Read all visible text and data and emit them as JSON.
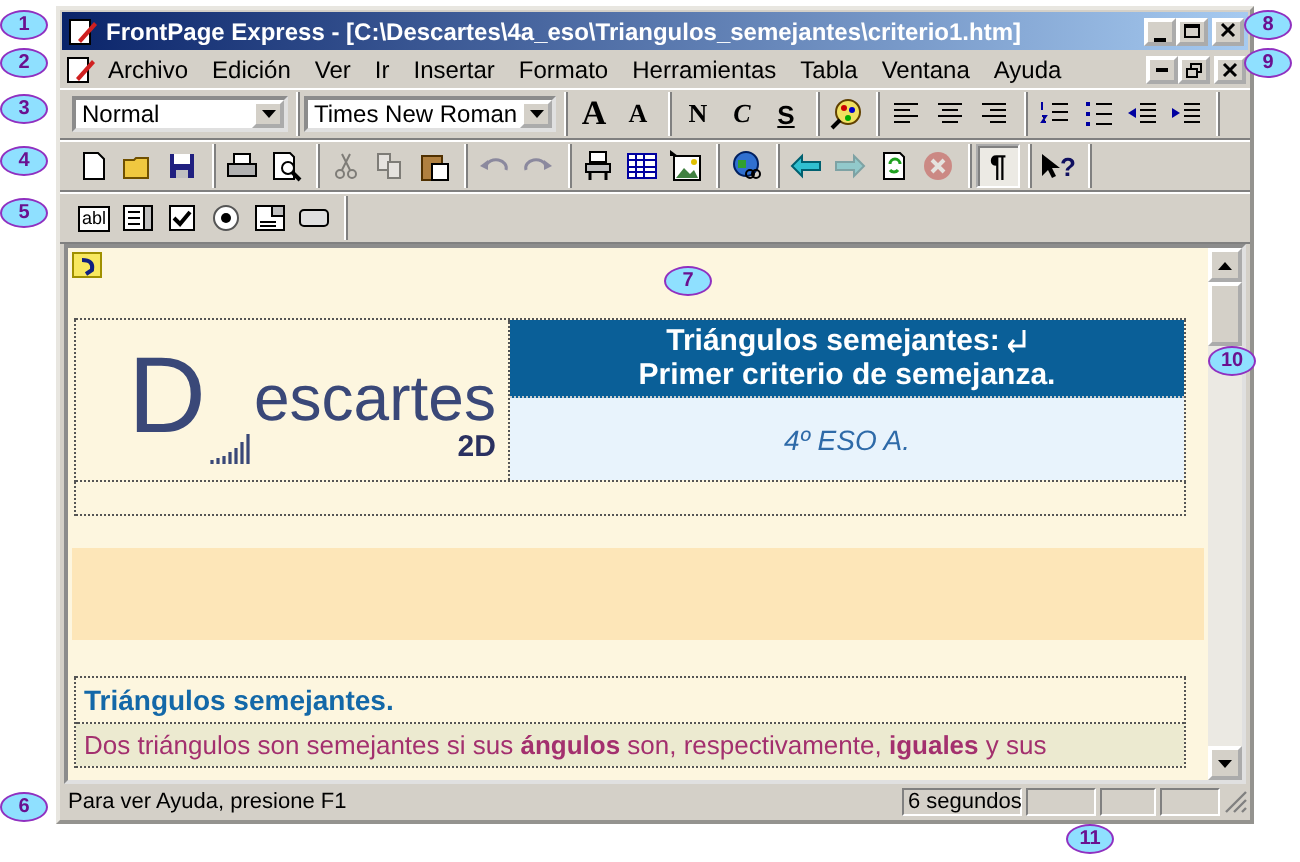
{
  "window": {
    "title": "FrontPage Express - [C:\\Descartes\\4a_eso\\Triangulos_semejantes\\criterio1.htm]"
  },
  "menu_bar": {
    "items": [
      "Archivo",
      "Edición",
      "Ver",
      "Ir",
      "Insertar",
      "Formato",
      "Herramientas",
      "Tabla",
      "Ventana",
      "Ayuda"
    ]
  },
  "toolbars": [
    {
      "groups": [
        [
          {
            "kind": "dropdown",
            "value": "Normal"
          }
        ],
        [
          {
            "kind": "fontbox",
            "value": "Times New Roman"
          }
        ],
        [
          {
            "kind": "grow",
            "label": "A",
            "disabled": false,
            "pressed": false
          },
          {
            "kind": "shrink",
            "label": "A",
            "disabled": false,
            "pressed": false
          }
        ],
        [
          {
            "kind": "bold",
            "label": "N",
            "disabled": false,
            "pressed": false
          },
          {
            "kind": "italic",
            "label": "C",
            "disabled": false,
            "pressed": false
          },
          {
            "kind": "underline",
            "label": "S",
            "disabled": false,
            "pressed": false
          }
        ],
        [
          {
            "kind": "color",
            "disabled": false,
            "pressed": false
          }
        ],
        [
          {
            "kind": "left",
            "disabled": false,
            "pressed": false
          },
          {
            "kind": "center",
            "disabled": false,
            "pressed": false
          },
          {
            "kind": "right",
            "disabled": false,
            "pressed": false
          }
        ],
        [
          {
            "kind": "numbers",
            "disabled": false,
            "pressed": false
          },
          {
            "kind": "bullets",
            "disabled": false,
            "pressed": false
          },
          {
            "kind": "outdent",
            "disabled": false,
            "pressed": false
          },
          {
            "kind": "indent",
            "disabled": false,
            "pressed": false
          }
        ]
      ]
    },
    {
      "groups": [
        [
          {
            "kind": "new",
            "disabled": false,
            "pressed": false
          },
          {
            "kind": "open",
            "disabled": false,
            "pressed": false
          },
          {
            "kind": "save",
            "disabled": false,
            "pressed": false
          }
        ],
        [
          {
            "kind": "print",
            "disabled": false,
            "pressed": false
          },
          {
            "kind": "preview",
            "disabled": false,
            "pressed": false
          }
        ],
        [
          {
            "kind": "cut",
            "disabled": true,
            "pressed": false
          },
          {
            "kind": "copy",
            "disabled": true,
            "pressed": false
          },
          {
            "kind": "paste",
            "disabled": false,
            "pressed": false
          }
        ],
        [
          {
            "kind": "undo",
            "disabled": true,
            "pressed": false
          },
          {
            "kind": "redo",
            "disabled": true,
            "pressed": false
          }
        ],
        [
          {
            "kind": "bot",
            "disabled": false,
            "pressed": false
          },
          {
            "kind": "table",
            "disabled": false,
            "pressed": false
          },
          {
            "kind": "image",
            "disabled": false,
            "pressed": false
          }
        ],
        [
          {
            "kind": "link",
            "disabled": false,
            "pressed": false
          }
        ],
        [
          {
            "kind": "back",
            "disabled": false,
            "pressed": false
          },
          {
            "kind": "forward",
            "disabled": true,
            "pressed": false
          },
          {
            "kind": "refresh",
            "disabled": false,
            "pressed": false
          },
          {
            "kind": "stop",
            "disabled": true,
            "pressed": false
          }
        ],
        [
          {
            "kind": "paragraph",
            "label": "¶",
            "disabled": false,
            "pressed": true
          }
        ],
        [
          {
            "kind": "help",
            "label": "?",
            "disabled": false,
            "pressed": false
          }
        ]
      ]
    },
    {
      "groups": [
        [
          {
            "kind": "textbox",
            "label": "abl",
            "disabled": false
          },
          {
            "kind": "textarea",
            "disabled": false
          },
          {
            "kind": "checkbox",
            "disabled": false
          },
          {
            "kind": "radio",
            "disabled": false
          },
          {
            "kind": "select",
            "disabled": false
          },
          {
            "kind": "pushbutton",
            "disabled": false
          }
        ]
      ]
    }
  ],
  "document": {
    "logo": {
      "initial": "D",
      "rest": "escartes",
      "tag": "2D"
    },
    "title_lines": [
      "Triángulos semejantes:",
      "Primer criterio de semejanza."
    ],
    "subtitle": "4º ESO A.",
    "section_title": "Triángulos semejantes.",
    "paragraph": "Dos triángulos son semejantes si sus **ángulos** son, respectivamente, **iguales** y sus"
  },
  "status_bar": {
    "message": "Para ver Ayuda, presione F1",
    "time": "6 segundos"
  },
  "callouts": [
    {
      "label": "1"
    },
    {
      "label": "2"
    },
    {
      "label": "3"
    },
    {
      "label": "4"
    },
    {
      "label": "5"
    },
    {
      "label": "6"
    },
    {
      "label": "7"
    },
    {
      "label": "8"
    },
    {
      "label": "9"
    },
    {
      "label": "10"
    },
    {
      "label": "11"
    }
  ]
}
